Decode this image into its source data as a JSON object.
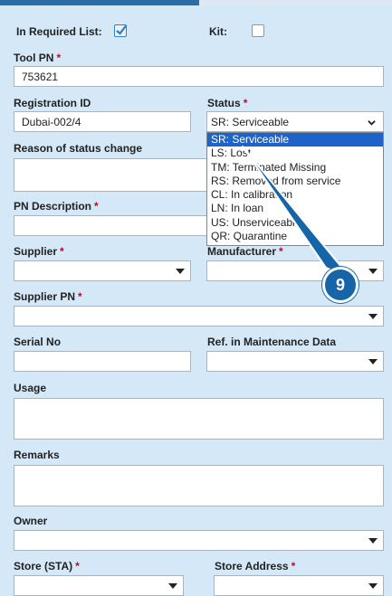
{
  "form": {
    "in_required_list_label": "In Required List:",
    "kit_label": "Kit:",
    "tool_pn": {
      "label": "Tool PN",
      "value": "753621"
    },
    "registration_id": {
      "label": "Registration ID",
      "value": "Dubai-002/4"
    },
    "status": {
      "label": "Status",
      "value": "SR: Serviceable"
    },
    "reason_label": "Reason of status change",
    "pn_description_label": "PN Description",
    "supplier_label": "Supplier",
    "manufacturer_label": "Manufacturer",
    "supplier_pn_label": "Supplier PN",
    "serial_no_label": "Serial No",
    "ref_maintenance_label": "Ref. in Maintenance Data",
    "usage_label": "Usage",
    "remarks_label": "Remarks",
    "owner_label": "Owner",
    "store_label": "Store (STA)",
    "store_address_label": "Store Address",
    "required_marker": "*"
  },
  "status_options": [
    "SR: Serviceable",
    "LS: Lost",
    "TM: Terminated Missing",
    "RS: Removed from service",
    "CL: In calibration",
    "LN: In loan",
    "US: Unserviceable",
    "QR: Quarantine"
  ],
  "callout": {
    "number": "9",
    "color": "#1565a8"
  },
  "colors": {
    "background": "#d5e8f8",
    "accent": "#2d6da6",
    "required": "#d0021b",
    "selected": "#1e64c8"
  },
  "icons": [
    "checkmark-icon",
    "chevron-down-icon",
    "caret-down-icon"
  ]
}
